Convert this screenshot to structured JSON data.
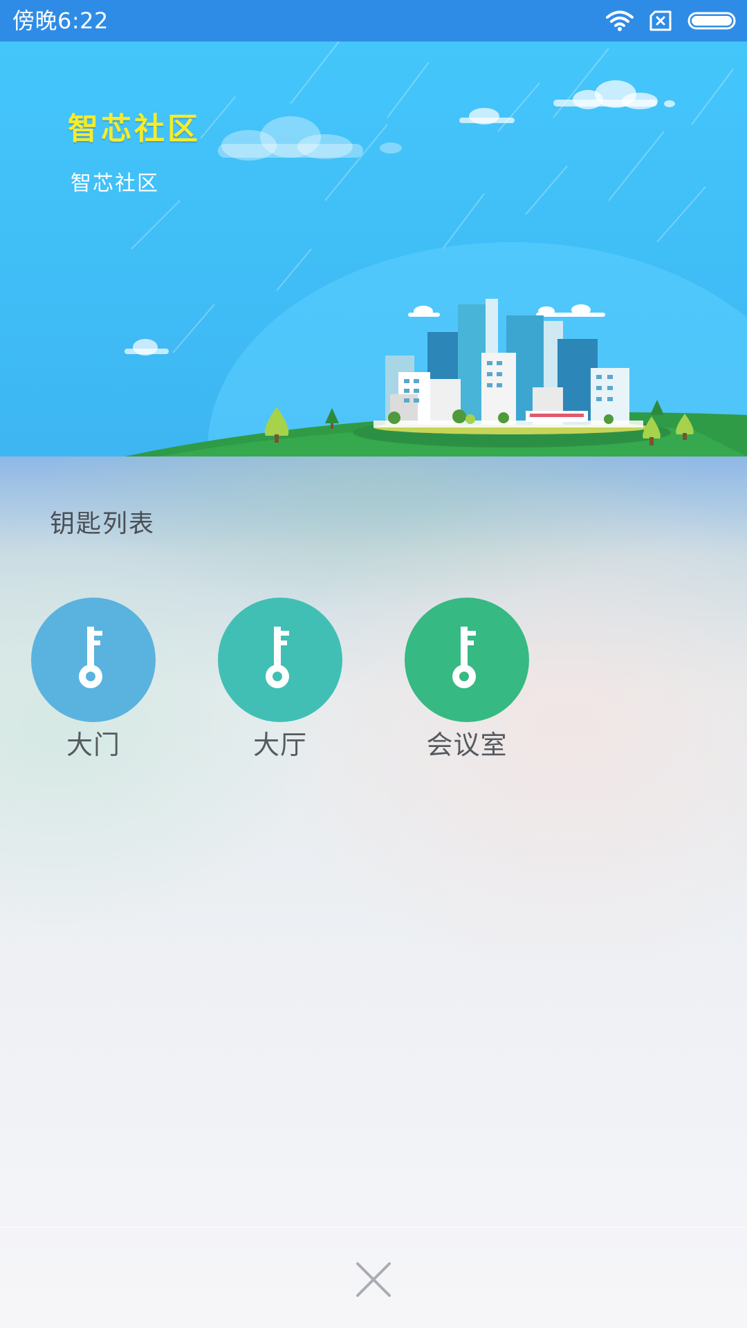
{
  "status_bar": {
    "time": "傍晚6:22",
    "icons": [
      "wifi-icon",
      "no-sim-icon",
      "battery-icon"
    ]
  },
  "banner": {
    "title": "智芯社区",
    "subtitle": "智芯社区"
  },
  "section_title": "钥匙列表",
  "keys": [
    {
      "label": "大门",
      "icon": "key-icon",
      "color": "#5ab3de"
    },
    {
      "label": "大厅",
      "icon": "key-icon",
      "color": "#41bfb4"
    },
    {
      "label": "会议室",
      "icon": "key-icon",
      "color": "#36b983"
    }
  ],
  "close_icon": "close-icon",
  "colors": {
    "status_bar": "#2f8ce6",
    "banner_sky": "#45c2f8",
    "banner_title": "#f5ec2a"
  }
}
